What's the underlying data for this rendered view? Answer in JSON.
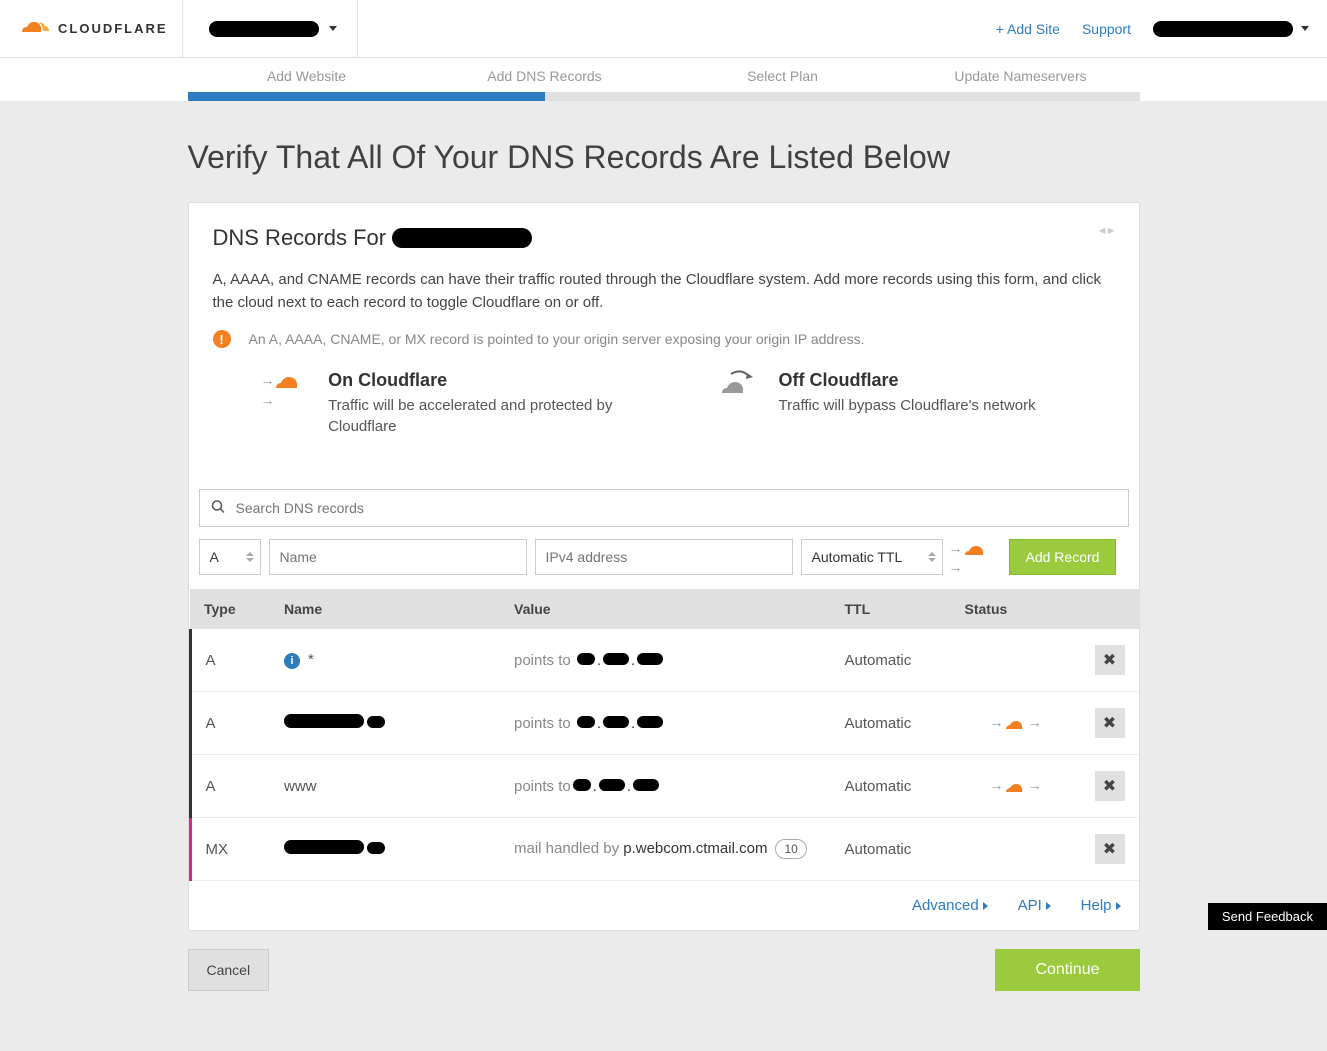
{
  "brand": "CLOUDFLARE",
  "topbar": {
    "add_site": "+ Add Site",
    "support": "Support"
  },
  "steps": [
    "Add Website",
    "Add DNS Records",
    "Select Plan",
    "Update Nameservers"
  ],
  "progress_pct": 37.5,
  "page_title": "Verify That All Of Your DNS Records Are Listed Below",
  "card": {
    "title_prefix": "DNS Records For",
    "desc": "A, AAAA, and CNAME records can have their traffic routed through the Cloudflare system. Add more records using this form, and click the cloud next to each record to toggle Cloudflare on or off.",
    "warning": "An A, AAAA, CNAME, or MX record is pointed to your origin server exposing your origin IP address."
  },
  "legend": {
    "on": {
      "title": "On Cloudflare",
      "desc": "Traffic will be accelerated and protected by Cloudflare"
    },
    "off": {
      "title": "Off Cloudflare",
      "desc": "Traffic will bypass Cloudflare's network"
    }
  },
  "search": {
    "placeholder": "Search DNS records"
  },
  "add_form": {
    "type": "A",
    "name_placeholder": "Name",
    "value_placeholder": "IPv4 address",
    "ttl": "Automatic TTL",
    "button": "Add Record"
  },
  "table": {
    "headers": [
      "Type",
      "Name",
      "Value",
      "TTL",
      "Status"
    ],
    "rows": [
      {
        "type": "A",
        "has_info": true,
        "name": "*",
        "name_redacted": false,
        "value_prefix": "points to ",
        "value_redacted": true,
        "ttl": "Automatic",
        "status": "none",
        "group": "a"
      },
      {
        "type": "A",
        "has_info": false,
        "name": "",
        "name_redacted": true,
        "value_prefix": "points to ",
        "value_redacted": true,
        "ttl": "Automatic",
        "status": "on",
        "group": "a"
      },
      {
        "type": "A",
        "has_info": false,
        "name": "www",
        "name_redacted": false,
        "value_prefix": "points to",
        "value_redacted": true,
        "ttl": "Automatic",
        "status": "on",
        "group": "a"
      },
      {
        "type": "MX",
        "has_info": false,
        "name": "",
        "name_redacted": true,
        "value_prefix": "mail handled by ",
        "value_text": "p.webcom.ctmail.com",
        "value_redacted": false,
        "priority": "10",
        "ttl": "Automatic",
        "status": "grey",
        "group": "mx"
      }
    ]
  },
  "footer_links": {
    "advanced": "Advanced",
    "api": "API",
    "help": "Help"
  },
  "actions": {
    "cancel": "Cancel",
    "continue": "Continue"
  },
  "feedback": "Send Feedback"
}
